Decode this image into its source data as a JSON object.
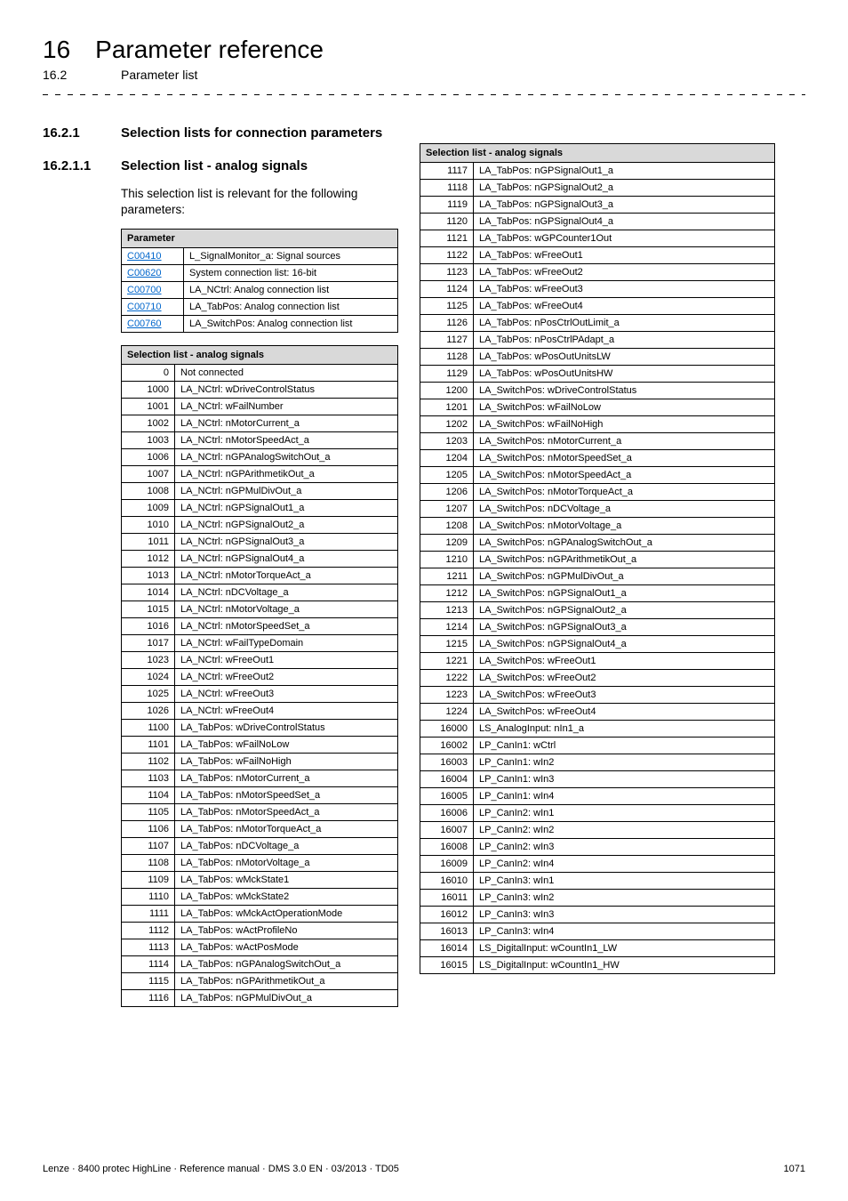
{
  "chapter": {
    "num": "16",
    "title": "Parameter reference"
  },
  "section": {
    "num": "16.2",
    "title": "Parameter list"
  },
  "h3": {
    "num": "16.2.1",
    "title": "Selection lists for connection parameters"
  },
  "h4": {
    "num": "16.2.1.1",
    "title": "Selection list - analog signals"
  },
  "intro": "This selection list is relevant for the following parameters:",
  "param_header": "Parameter",
  "params": [
    {
      "code": "C00410",
      "desc": "L_SignalMonitor_a: Signal sources"
    },
    {
      "code": "C00620",
      "desc": "System connection list: 16-bit"
    },
    {
      "code": "C00700",
      "desc": "LA_NCtrl: Analog connection list"
    },
    {
      "code": "C00710",
      "desc": "LA_TabPos: Analog connection list"
    },
    {
      "code": "C00760",
      "desc": "LA_SwitchPos: Analog connection list"
    }
  ],
  "sel_header": "Selection list - analog signals",
  "sel_left": [
    {
      "n": "0",
      "t": "Not connected"
    },
    {
      "n": "1000",
      "t": "LA_NCtrl: wDriveControlStatus"
    },
    {
      "n": "1001",
      "t": "LA_NCtrl: wFailNumber"
    },
    {
      "n": "1002",
      "t": "LA_NCtrl: nMotorCurrent_a"
    },
    {
      "n": "1003",
      "t": "LA_NCtrl: nMotorSpeedAct_a"
    },
    {
      "n": "1006",
      "t": "LA_NCtrl: nGPAnalogSwitchOut_a"
    },
    {
      "n": "1007",
      "t": "LA_NCtrl: nGPArithmetikOut_a"
    },
    {
      "n": "1008",
      "t": "LA_NCtrl: nGPMulDivOut_a"
    },
    {
      "n": "1009",
      "t": "LA_NCtrl: nGPSignalOut1_a"
    },
    {
      "n": "1010",
      "t": "LA_NCtrl: nGPSignalOut2_a"
    },
    {
      "n": "1011",
      "t": "LA_NCtrl: nGPSignalOut3_a"
    },
    {
      "n": "1012",
      "t": "LA_NCtrl: nGPSignalOut4_a"
    },
    {
      "n": "1013",
      "t": "LA_NCtrl: nMotorTorqueAct_a"
    },
    {
      "n": "1014",
      "t": "LA_NCtrl: nDCVoltage_a"
    },
    {
      "n": "1015",
      "t": "LA_NCtrl: nMotorVoltage_a"
    },
    {
      "n": "1016",
      "t": "LA_NCtrl: nMotorSpeedSet_a"
    },
    {
      "n": "1017",
      "t": "LA_NCtrl: wFailTypeDomain"
    },
    {
      "n": "1023",
      "t": "LA_NCtrl: wFreeOut1"
    },
    {
      "n": "1024",
      "t": "LA_NCtrl: wFreeOut2"
    },
    {
      "n": "1025",
      "t": "LA_NCtrl: wFreeOut3"
    },
    {
      "n": "1026",
      "t": "LA_NCtrl: wFreeOut4"
    },
    {
      "n": "1100",
      "t": "LA_TabPos: wDriveControlStatus"
    },
    {
      "n": "1101",
      "t": "LA_TabPos: wFailNoLow"
    },
    {
      "n": "1102",
      "t": "LA_TabPos: wFailNoHigh"
    },
    {
      "n": "1103",
      "t": "LA_TabPos: nMotorCurrent_a"
    },
    {
      "n": "1104",
      "t": "LA_TabPos: nMotorSpeedSet_a"
    },
    {
      "n": "1105",
      "t": "LA_TabPos: nMotorSpeedAct_a"
    },
    {
      "n": "1106",
      "t": "LA_TabPos: nMotorTorqueAct_a"
    },
    {
      "n": "1107",
      "t": "LA_TabPos: nDCVoltage_a"
    },
    {
      "n": "1108",
      "t": "LA_TabPos: nMotorVoltage_a"
    },
    {
      "n": "1109",
      "t": "LA_TabPos: wMckState1"
    },
    {
      "n": "1110",
      "t": "LA_TabPos: wMckState2"
    },
    {
      "n": "1111",
      "t": "LA_TabPos: wMckActOperationMode"
    },
    {
      "n": "1112",
      "t": "LA_TabPos: wActProfileNo"
    },
    {
      "n": "1113",
      "t": "LA_TabPos: wActPosMode"
    },
    {
      "n": "1114",
      "t": "LA_TabPos: nGPAnalogSwitchOut_a"
    },
    {
      "n": "1115",
      "t": "LA_TabPos: nGPArithmetikOut_a"
    },
    {
      "n": "1116",
      "t": "LA_TabPos: nGPMulDivOut_a"
    }
  ],
  "sel_right": [
    {
      "n": "1117",
      "t": "LA_TabPos: nGPSignalOut1_a"
    },
    {
      "n": "1118",
      "t": "LA_TabPos: nGPSignalOut2_a"
    },
    {
      "n": "1119",
      "t": "LA_TabPos: nGPSignalOut3_a"
    },
    {
      "n": "1120",
      "t": "LA_TabPos: nGPSignalOut4_a"
    },
    {
      "n": "1121",
      "t": "LA_TabPos: wGPCounter1Out"
    },
    {
      "n": "1122",
      "t": "LA_TabPos: wFreeOut1"
    },
    {
      "n": "1123",
      "t": "LA_TabPos: wFreeOut2"
    },
    {
      "n": "1124",
      "t": "LA_TabPos: wFreeOut3"
    },
    {
      "n": "1125",
      "t": "LA_TabPos: wFreeOut4"
    },
    {
      "n": "1126",
      "t": "LA_TabPos: nPosCtrlOutLimit_a"
    },
    {
      "n": "1127",
      "t": "LA_TabPos: nPosCtrlPAdapt_a"
    },
    {
      "n": "1128",
      "t": "LA_TabPos: wPosOutUnitsLW"
    },
    {
      "n": "1129",
      "t": "LA_TabPos: wPosOutUnitsHW"
    },
    {
      "n": "1200",
      "t": "LA_SwitchPos: wDriveControlStatus"
    },
    {
      "n": "1201",
      "t": "LA_SwitchPos: wFailNoLow"
    },
    {
      "n": "1202",
      "t": "LA_SwitchPos: wFailNoHigh"
    },
    {
      "n": "1203",
      "t": "LA_SwitchPos: nMotorCurrent_a"
    },
    {
      "n": "1204",
      "t": "LA_SwitchPos: nMotorSpeedSet_a"
    },
    {
      "n": "1205",
      "t": "LA_SwitchPos: nMotorSpeedAct_a"
    },
    {
      "n": "1206",
      "t": "LA_SwitchPos: nMotorTorqueAct_a"
    },
    {
      "n": "1207",
      "t": "LA_SwitchPos: nDCVoltage_a"
    },
    {
      "n": "1208",
      "t": "LA_SwitchPos: nMotorVoltage_a"
    },
    {
      "n": "1209",
      "t": "LA_SwitchPos: nGPAnalogSwitchOut_a"
    },
    {
      "n": "1210",
      "t": "LA_SwitchPos: nGPArithmetikOut_a"
    },
    {
      "n": "1211",
      "t": "LA_SwitchPos: nGPMulDivOut_a"
    },
    {
      "n": "1212",
      "t": "LA_SwitchPos: nGPSignalOut1_a"
    },
    {
      "n": "1213",
      "t": "LA_SwitchPos: nGPSignalOut2_a"
    },
    {
      "n": "1214",
      "t": "LA_SwitchPos: nGPSignalOut3_a"
    },
    {
      "n": "1215",
      "t": "LA_SwitchPos: nGPSignalOut4_a"
    },
    {
      "n": "1221",
      "t": "LA_SwitchPos: wFreeOut1"
    },
    {
      "n": "1222",
      "t": "LA_SwitchPos: wFreeOut2"
    },
    {
      "n": "1223",
      "t": "LA_SwitchPos: wFreeOut3"
    },
    {
      "n": "1224",
      "t": "LA_SwitchPos: wFreeOut4"
    },
    {
      "n": "16000",
      "t": "LS_AnalogInput: nIn1_a"
    },
    {
      "n": "16002",
      "t": "LP_CanIn1: wCtrl"
    },
    {
      "n": "16003",
      "t": "LP_CanIn1: wIn2"
    },
    {
      "n": "16004",
      "t": "LP_CanIn1: wIn3"
    },
    {
      "n": "16005",
      "t": "LP_CanIn1: wIn4"
    },
    {
      "n": "16006",
      "t": "LP_CanIn2: wIn1"
    },
    {
      "n": "16007",
      "t": "LP_CanIn2: wIn2"
    },
    {
      "n": "16008",
      "t": "LP_CanIn2: wIn3"
    },
    {
      "n": "16009",
      "t": "LP_CanIn2: wIn4"
    },
    {
      "n": "16010",
      "t": "LP_CanIn3: wIn1"
    },
    {
      "n": "16011",
      "t": "LP_CanIn3: wIn2"
    },
    {
      "n": "16012",
      "t": "LP_CanIn3: wIn3"
    },
    {
      "n": "16013",
      "t": "LP_CanIn3: wIn4"
    },
    {
      "n": "16014",
      "t": "LS_DigitalInput: wCountIn1_LW"
    },
    {
      "n": "16015",
      "t": "LS_DigitalInput: wCountIn1_HW"
    }
  ],
  "footer": {
    "left": "Lenze · 8400 protec HighLine · Reference manual · DMS 3.0 EN · 03/2013 · TD05",
    "right": "1071"
  }
}
